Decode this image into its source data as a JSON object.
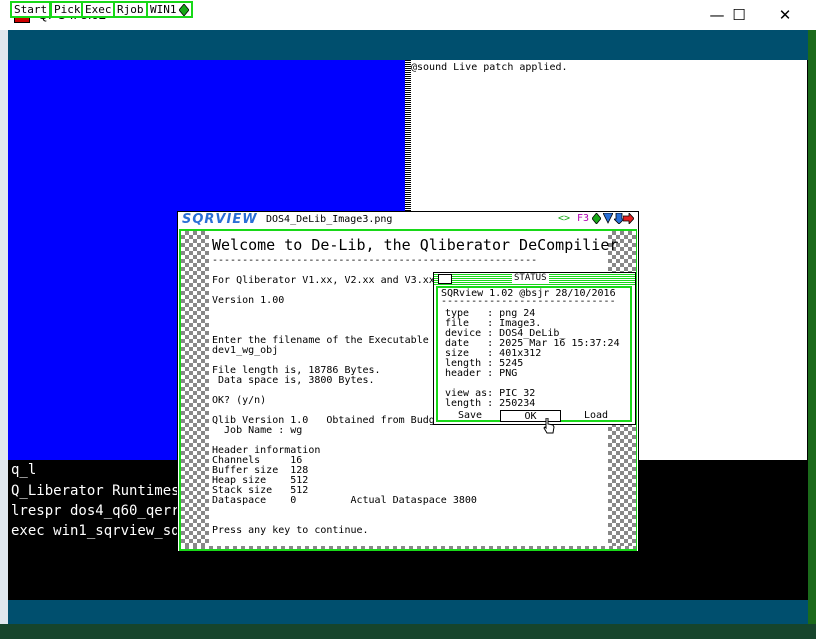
{
  "window": {
    "title": "QPC II 5.02",
    "minimize_glyph": "—",
    "maximize_glyph": "☐",
    "close_glyph": "✕"
  },
  "toolbar": {
    "buttons": [
      "Start",
      "Pick",
      "Exec",
      "Rjob",
      "WIN1"
    ],
    "win1_icon": "green-diamond"
  },
  "sound_window": {
    "message": "@sound Live patch applied."
  },
  "console": {
    "lines": [
      "q_l",
      "Q_Liberator Runtimes",
      "lrespr dos4_q60_qerr6",
      "exec win1_sqrview_sqr"
    ]
  },
  "sqrview": {
    "logo": "SQRVIEW",
    "filename": "DOS4_DeLib_Image3.png",
    "controls": [
      "<>",
      "F3"
    ],
    "welcome": "Welcome to De-Lib, the Qliberator DeCompilier",
    "dashes": "------------------------------------------------------",
    "lines": [
      "For Qliberator V1.xx, V2.xx and V3.xx",
      "",
      "Version 1.00",
      "",
      "",
      "",
      "Enter the filename of the Executable",
      "dev1_wg_obj",
      "",
      "File length is, 18786 Bytes.",
      " Data space is, 3800 Bytes.",
      "",
      "OK? (y/n)",
      "",
      "Qlib Version 1.0   Obtained from Budg",
      "  Job Name : wg",
      "",
      "Header information",
      "Channels     16",
      "Buffer size  128",
      "Heap size    512",
      "Stack size   512",
      "Dataspace    0         Actual Dataspace 3800",
      "",
      "Press any key to continue."
    ]
  },
  "status_dialog": {
    "title": "STATUS",
    "header": "SQRview 1.02 @bsjr 28/10/2016",
    "rule": "-----------------------------",
    "fields": [
      "type   : png 24",
      "file   : Image3.",
      "device : DOS4_DeLib_",
      "date   : 2025 Mar 16 15:37:24",
      "size   : 401x312",
      "length : 5245",
      "header : PNG",
      "",
      "view as: PIC 32",
      "length : 250234"
    ],
    "buttons": {
      "save": "Save",
      "ok": "OK",
      "load": "Load"
    }
  }
}
